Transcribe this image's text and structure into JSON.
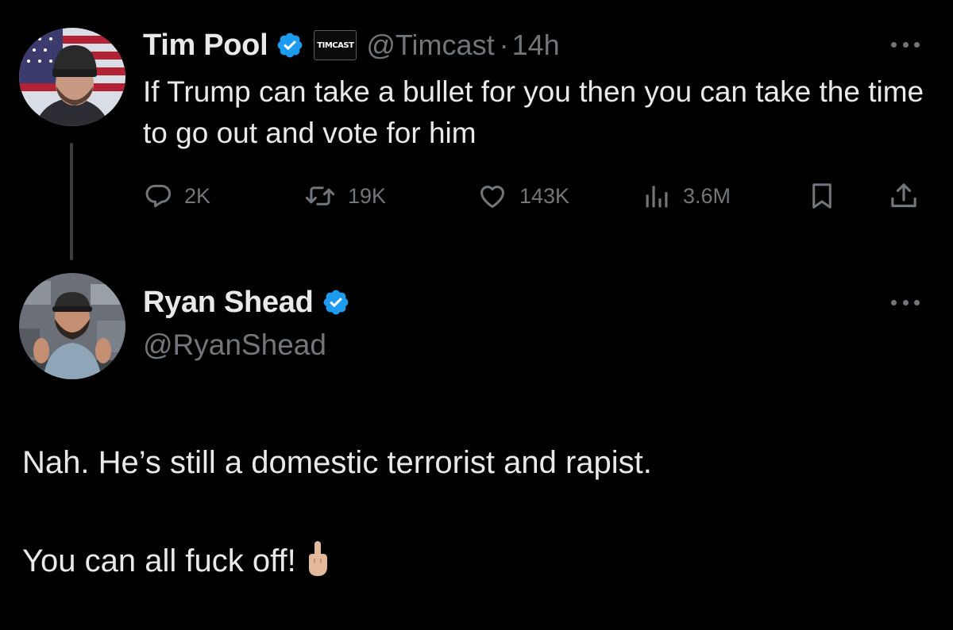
{
  "parent_tweet": {
    "author_name": "Tim Pool",
    "affiliate_label": "TIMCAST",
    "handle": "@Timcast",
    "separator": "·",
    "timestamp": "14h",
    "text": "If Trump can take a bullet for you then you can take the time to go out and vote for him",
    "metrics": {
      "replies": "2K",
      "retweets": "19K",
      "likes": "143K",
      "views": "3.6M"
    }
  },
  "reply_tweet": {
    "author_name": "Ryan Shead",
    "handle": "@RyanShead",
    "text_paragraph_1": "Nah. He’s still a domestic terrorist and rapist.",
    "text_paragraph_2": "You can all fuck off!"
  },
  "colors": {
    "background": "#000000",
    "primary_text": "#e7e9ea",
    "secondary_text": "#71767b",
    "verified_blue": "#1d9bf0",
    "thread_line": "#3a3d40"
  },
  "icons": {
    "verified": "verified-badge-icon",
    "reply": "reply-bubble-icon",
    "retweet": "retweet-arrows-icon",
    "like": "heart-icon",
    "views": "bar-chart-icon",
    "bookmark": "bookmark-icon",
    "share": "share-upload-icon",
    "more": "more-dots-icon",
    "emoji": "middle-finger-emoji"
  }
}
